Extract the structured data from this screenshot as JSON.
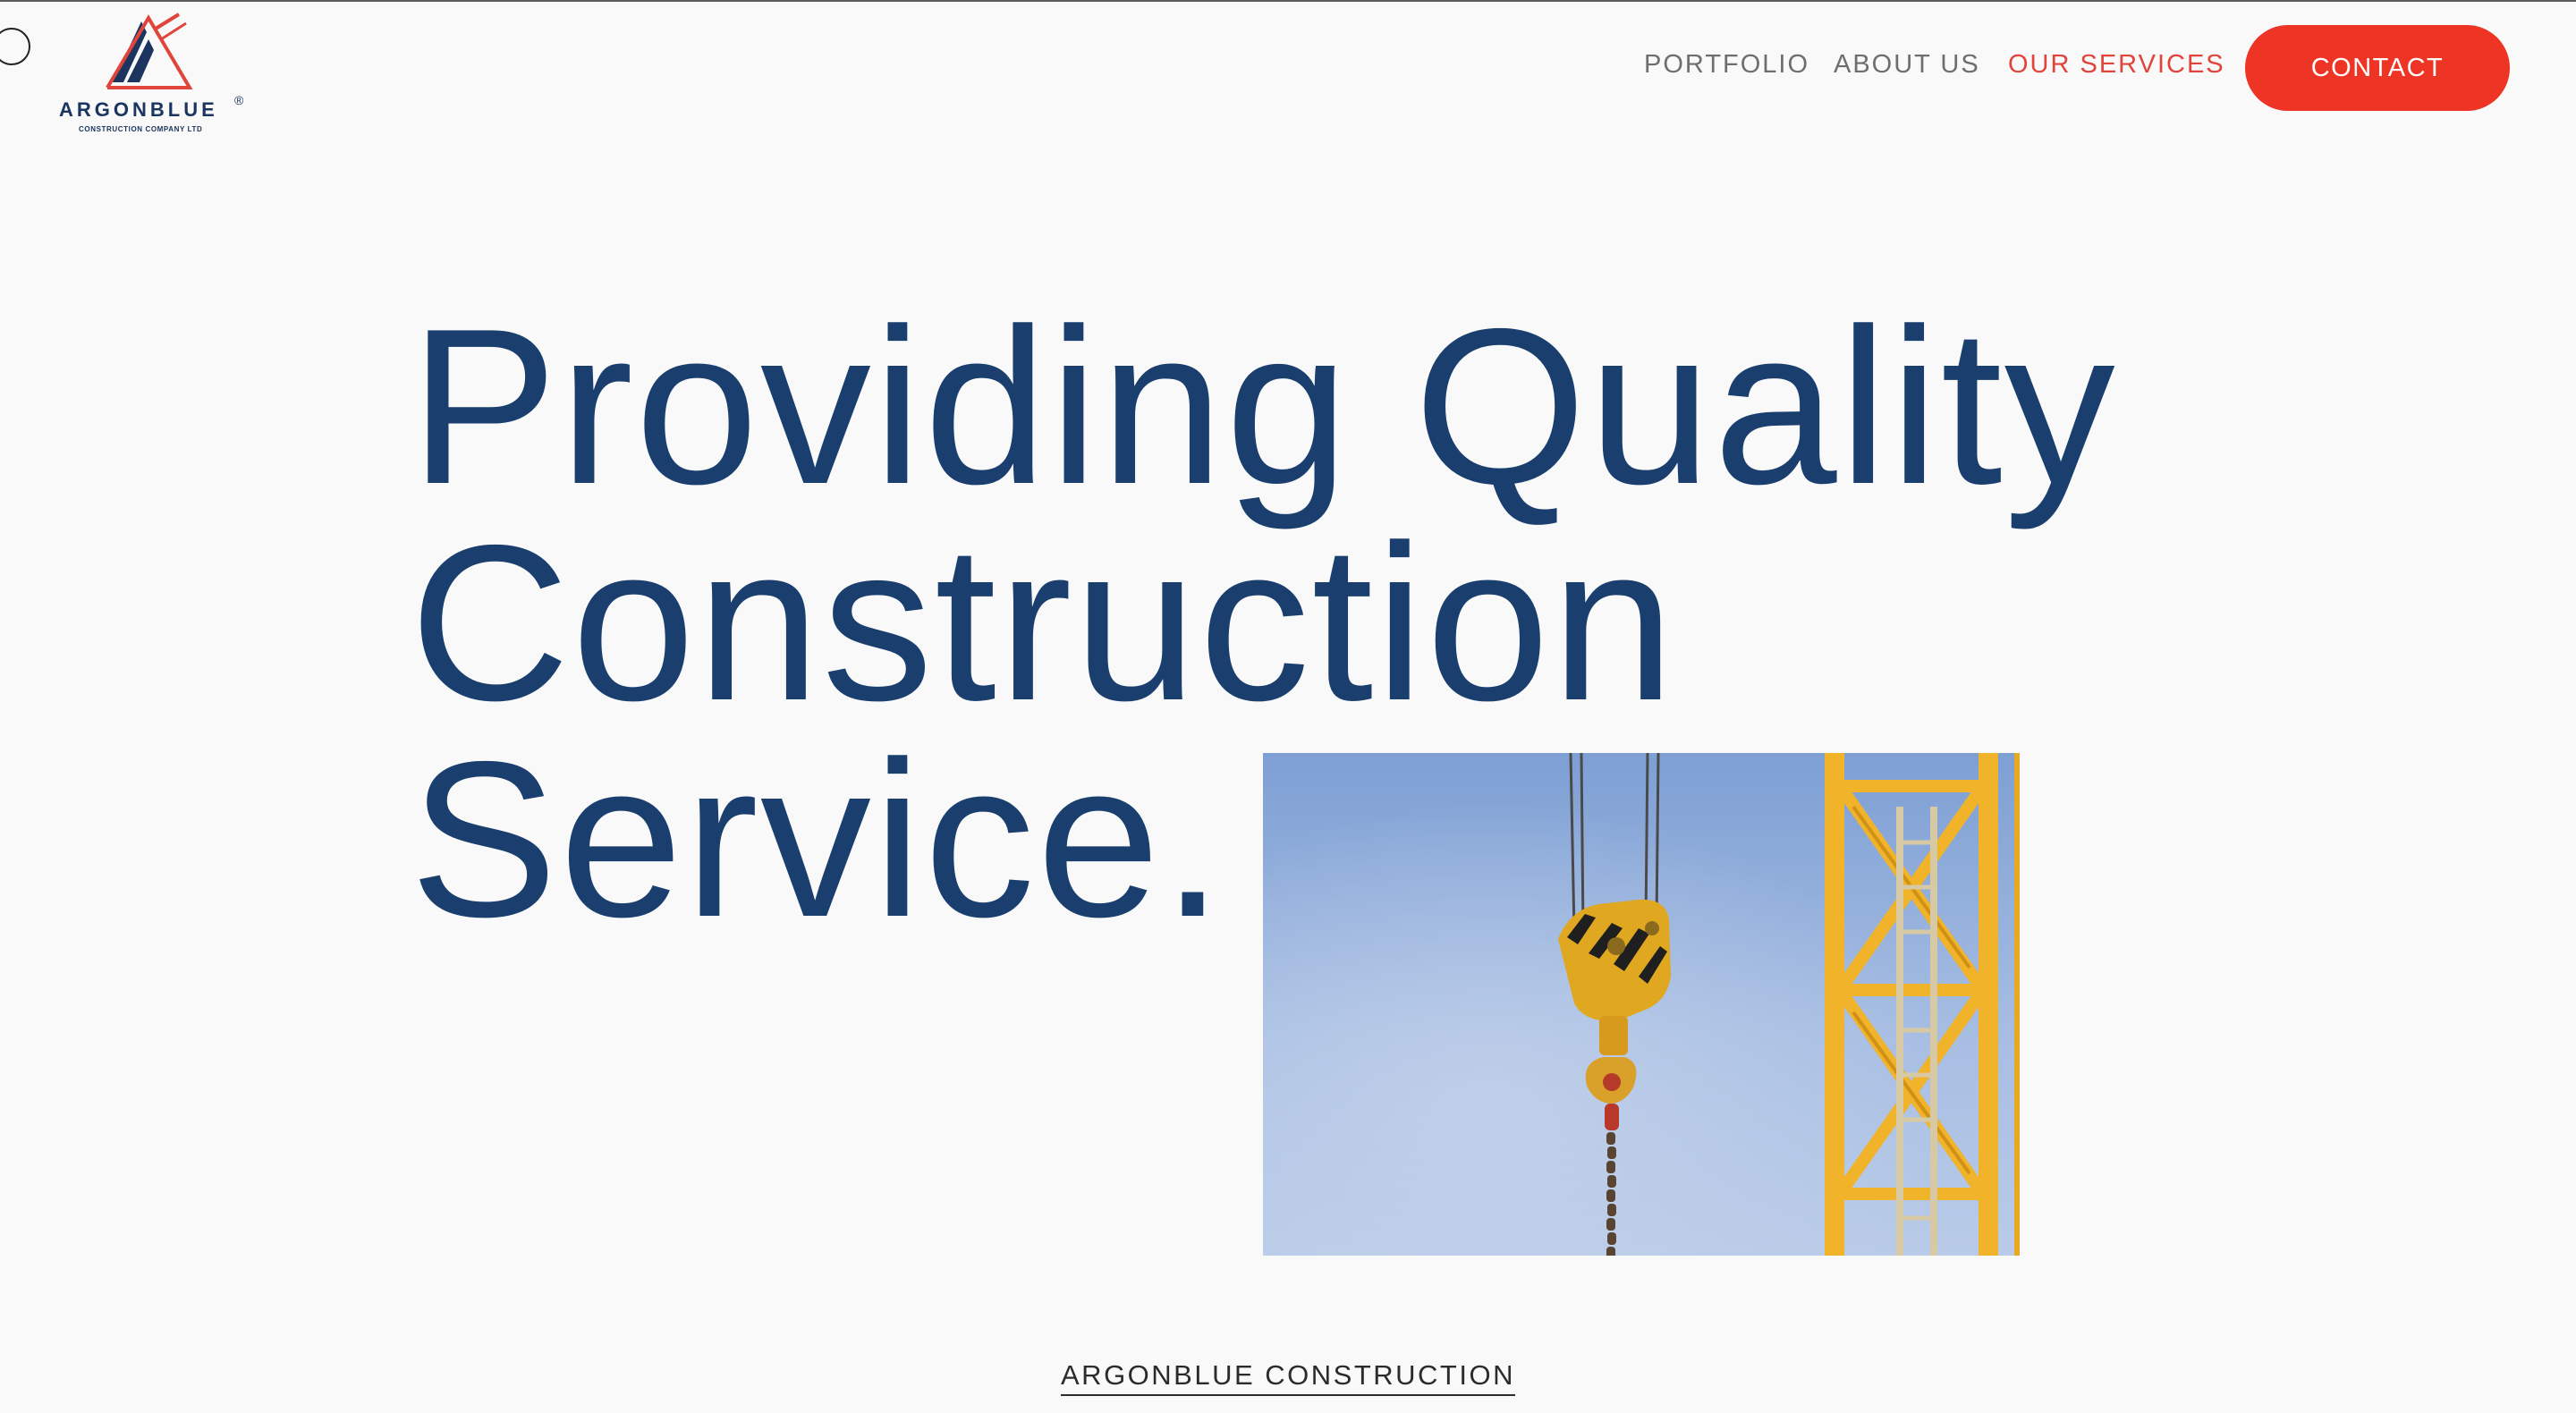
{
  "brand": {
    "name": "ARGONBLUE",
    "registered_mark": "®",
    "tagline": "CONSTRUCTION COMPANY LTD",
    "navy": "#1b3560",
    "red": "#e0443a"
  },
  "nav": {
    "items": [
      {
        "label": "PORTFOLIO",
        "active": false
      },
      {
        "label": "ABOUT US",
        "active": false
      },
      {
        "label": "OUR SERVICES",
        "active": true
      }
    ],
    "contact_label": "CONTACT"
  },
  "hero": {
    "lines": [
      "Providing Quality",
      "Construction",
      "Service."
    ],
    "color": "#1a3f6e",
    "photo_icon": "crane-hook-photo"
  },
  "footer": {
    "link_label": "ARGONBLUE CONSTRUCTION"
  }
}
